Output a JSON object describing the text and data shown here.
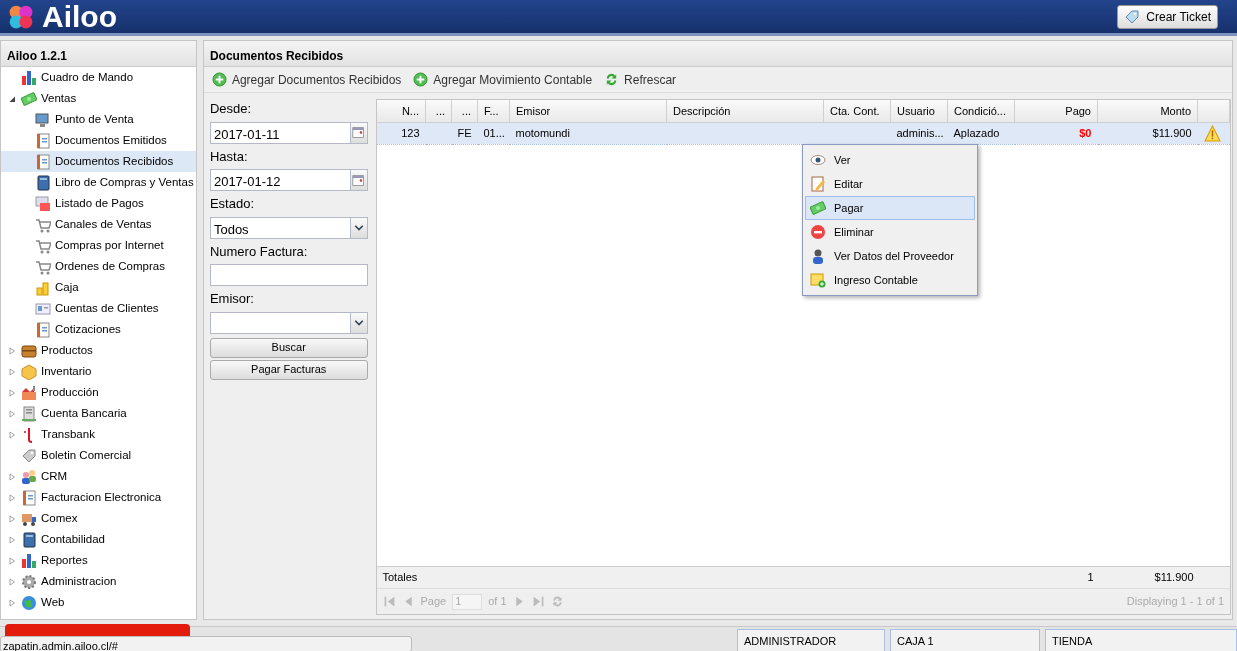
{
  "header": {
    "logo": "Ailoo",
    "ticket_button": "Crear Ticket"
  },
  "sidebar": {
    "title": "Ailoo 1.2.1",
    "items": [
      {
        "label": "Cuadro de Mando",
        "selected": false
      },
      {
        "label": "Ventas",
        "selected": false,
        "expanded": true,
        "children": [
          {
            "label": "Punto de Venta",
            "selected": false
          },
          {
            "label": "Documentos Emitidos",
            "selected": false
          },
          {
            "label": "Documentos Recibidos",
            "selected": true
          },
          {
            "label": "Libro de Compras y Ventas",
            "selected": false
          },
          {
            "label": "Listado de Pagos",
            "selected": false
          },
          {
            "label": "Canales de Ventas",
            "selected": false
          },
          {
            "label": "Compras por Internet",
            "selected": false
          },
          {
            "label": "Ordenes de Compras",
            "selected": false
          },
          {
            "label": "Caja",
            "selected": false
          },
          {
            "label": "Cuentas de Clientes",
            "selected": false
          },
          {
            "label": "Cotizaciones",
            "selected": false
          }
        ]
      },
      {
        "label": "Productos",
        "selected": false,
        "expanded": false
      },
      {
        "label": "Inventario",
        "selected": false,
        "expanded": false
      },
      {
        "label": "Producción",
        "selected": false,
        "expanded": false
      },
      {
        "label": "Cuenta Bancaria",
        "selected": false,
        "expanded": false
      },
      {
        "label": "Transbank",
        "selected": false,
        "expanded": false
      },
      {
        "label": "Boletin Comercial",
        "selected": false
      },
      {
        "label": "CRM",
        "selected": false,
        "expanded": false
      },
      {
        "label": "Facturacion Electronica",
        "selected": false,
        "expanded": false
      },
      {
        "label": "Comex",
        "selected": false,
        "expanded": false
      },
      {
        "label": "Contabilidad",
        "selected": false,
        "expanded": false
      },
      {
        "label": "Reportes",
        "selected": false,
        "expanded": false
      },
      {
        "label": "Administracion",
        "selected": false,
        "expanded": false
      },
      {
        "label": "Web",
        "selected": false,
        "expanded": false
      }
    ]
  },
  "main": {
    "title": "Documentos Recibidos",
    "toolbar": [
      "Agregar Documentos Recibidos",
      "Agregar Movimiento Contable",
      "Refrescar"
    ],
    "filters": [
      {
        "kind": "date",
        "label": "Desde:",
        "value": "2017-01-11"
      },
      {
        "kind": "date",
        "label": "Hasta:",
        "value": "2017-01-12"
      },
      {
        "kind": "select",
        "label": "Estado:",
        "value": "Todos"
      },
      {
        "kind": "text",
        "label": "Numero Factura:"
      },
      {
        "kind": "select",
        "label": "Emisor:"
      }
    ],
    "filter_buttons": [
      "Buscar",
      "Pagar Facturas"
    ],
    "table": {
      "columns": [
        "N...",
        "...",
        "...",
        "F...",
        "Emisor",
        "Descripción",
        "Cta. Cont.",
        "Usuario",
        "Condició...",
        "Pago",
        "Monto"
      ],
      "rows": [
        {
          "selected": true,
          "unpaid": true,
          "warning": true,
          "cells": [
            "123",
            null,
            "FE",
            "01...",
            "motomundi",
            null,
            null,
            "adminis...",
            "Aplazado",
            "$0",
            "$11.900"
          ]
        }
      ],
      "totals": {
        "label": "Totales",
        "pago": "1",
        "monto": "$11.900"
      }
    },
    "pager": {
      "page_label": "Page",
      "page": "1",
      "of": "of 1",
      "info": "Displaying 1 - 1 of 1"
    },
    "context_menu": [
      {
        "label": "Ver",
        "selected": false
      },
      {
        "label": "Editar",
        "selected": false
      },
      {
        "label": "Pagar",
        "selected": true
      },
      {
        "label": "Eliminar",
        "selected": false
      },
      {
        "label": "Ver Datos del Proveedor",
        "selected": false
      },
      {
        "label": "Ingreso Contable",
        "selected": false
      }
    ]
  },
  "status_bar": [
    "ADMINISTRADOR",
    "CAJA 1",
    "TIENDA"
  ],
  "link_preview": "zapatin.admin.ailoo.cl/#"
}
